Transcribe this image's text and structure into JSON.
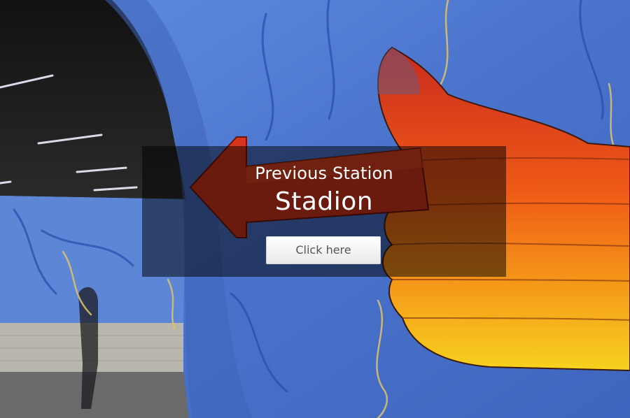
{
  "hero": {
    "label": "Previous Station",
    "station_name": "Stadion",
    "button_label": "Click here"
  },
  "colors": {
    "rock_blue": "#4a73c9",
    "arrow_red": "#d8351a",
    "arrow_orange": "#f06a12",
    "arrow_yellow": "#f7c91e",
    "overlay": "rgba(0,0,0,0.5)"
  }
}
